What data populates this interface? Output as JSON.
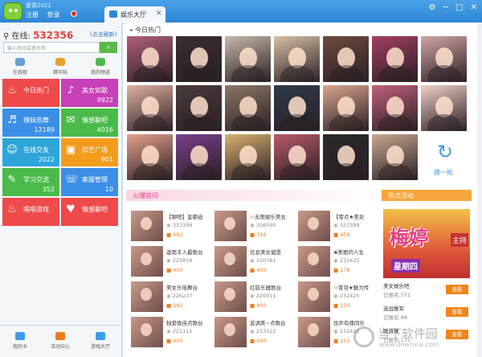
{
  "app": {
    "brand": "爱客2021",
    "login": "注册",
    "register": "登录",
    "tab_label": "娱乐大厅",
    "tab_close": "✕"
  },
  "window_buttons": [
    "⚙",
    "─",
    "□",
    "✕"
  ],
  "sidebar": {
    "online_label": "在线:",
    "online_count": "532356",
    "refresh": "(点击刷新)",
    "search_placeholder": "输入房间或者名称",
    "subnav": [
      "在线观",
      "精华帖",
      "我的频道"
    ],
    "tiles": [
      {
        "label": "今日热门",
        "count": "",
        "color": "#ee4a4a",
        "icon": "fire-icon"
      },
      {
        "label": "美女如歌",
        "count": "9922",
        "color": "#c740b8",
        "icon": "music-icon"
      },
      {
        "label": "辣妹热舞",
        "count": "12189",
        "color": "#3b8fe6",
        "icon": "dance-icon"
      },
      {
        "label": "情感聊吧",
        "count": "4016",
        "color": "#4aba4a",
        "icon": "chat-icon"
      },
      {
        "label": "在线交友",
        "count": "2022",
        "color": "#2ea5d9",
        "icon": "friends-icon"
      },
      {
        "label": "综艺广场",
        "count": "901",
        "color": "#f39c1c",
        "icon": "square-icon"
      },
      {
        "label": "学习交流",
        "count": "352",
        "color": "#4aba4a",
        "icon": "study-icon"
      },
      {
        "label": "客服管理",
        "count": "10",
        "color": "#3b8fe6",
        "icon": "service-icon"
      },
      {
        "label": "唱唱游戏",
        "count": "",
        "color": "#ee4a4a",
        "icon": "game-icon"
      },
      {
        "label": "情感聊吧",
        "count": "",
        "color": "#ee4a4a",
        "icon": "heart-icon"
      }
    ],
    "bottom": [
      "我的卡",
      "活动中心",
      "游戏大厅"
    ]
  },
  "main": {
    "hot_title": "今日热门",
    "switch_label": "换一批",
    "fire_title": "火爆房间",
    "activity_title": "热点活动",
    "avatar_colors": [
      "#b25f7a",
      "#3a2d34",
      "#c7b8a8",
      "#d9bfa5",
      "#6e4b3c",
      "#a43e62",
      "#d2a5a5",
      "#e0b0a0",
      "#4a3a3a",
      "#8c7866",
      "#2e3a4a",
      "#d9a58c",
      "#c0607a",
      "#f0d0c8",
      "#e6a08a",
      "#7a3e8c",
      "#d8b070",
      "#b85a68",
      "#2a2a2a",
      "#c9a890"
    ],
    "rooms": [
      {
        "name": "【聊吧】皇朝迪",
        "views": "333399",
        "count": "682"
      },
      {
        "name": "☆无限娱乐美女",
        "views": "356090",
        "count": "316"
      },
      {
        "name": "【零点★美女",
        "views": "327399",
        "count": "458"
      },
      {
        "name": "迦南丰人最歌台",
        "views": "225858",
        "count": "400"
      },
      {
        "name": "信息美女城堡",
        "views": "320781",
        "count": "400"
      },
      {
        "name": "❀美丽的人生",
        "views": "232425",
        "count": "178"
      },
      {
        "name": "美女乐瑶舞台",
        "views": "226237",
        "count": "282"
      },
      {
        "name": "红唇乐器歌台",
        "views": "220011",
        "count": "400"
      },
      {
        "name": "☆苍穹★魅力传",
        "views": "232425",
        "count": "150"
      },
      {
        "name": "独爱极佳点歌台",
        "views": "221111",
        "count": "400"
      },
      {
        "name": "蓝调美~点歌台",
        "views": "233322",
        "count": "400"
      },
      {
        "name": "优声有缘同乐",
        "views": "232425",
        "count": "151"
      }
    ],
    "promo": {
      "big": "梅婷",
      "tag": "主持",
      "sub": "星期四"
    },
    "activities": [
      {
        "name": "美女娱乐吧",
        "sub": "已报名:571",
        "btn": "查看"
      },
      {
        "name": "选战雅军",
        "sub": "已报名:88",
        "btn": "查看"
      },
      {
        "name": "联旗赛",
        "sub": "已报名:171",
        "btn": "查看"
      }
    ],
    "watermark": {
      "title": "当下软件园",
      "url": "www.downxia.com"
    }
  }
}
